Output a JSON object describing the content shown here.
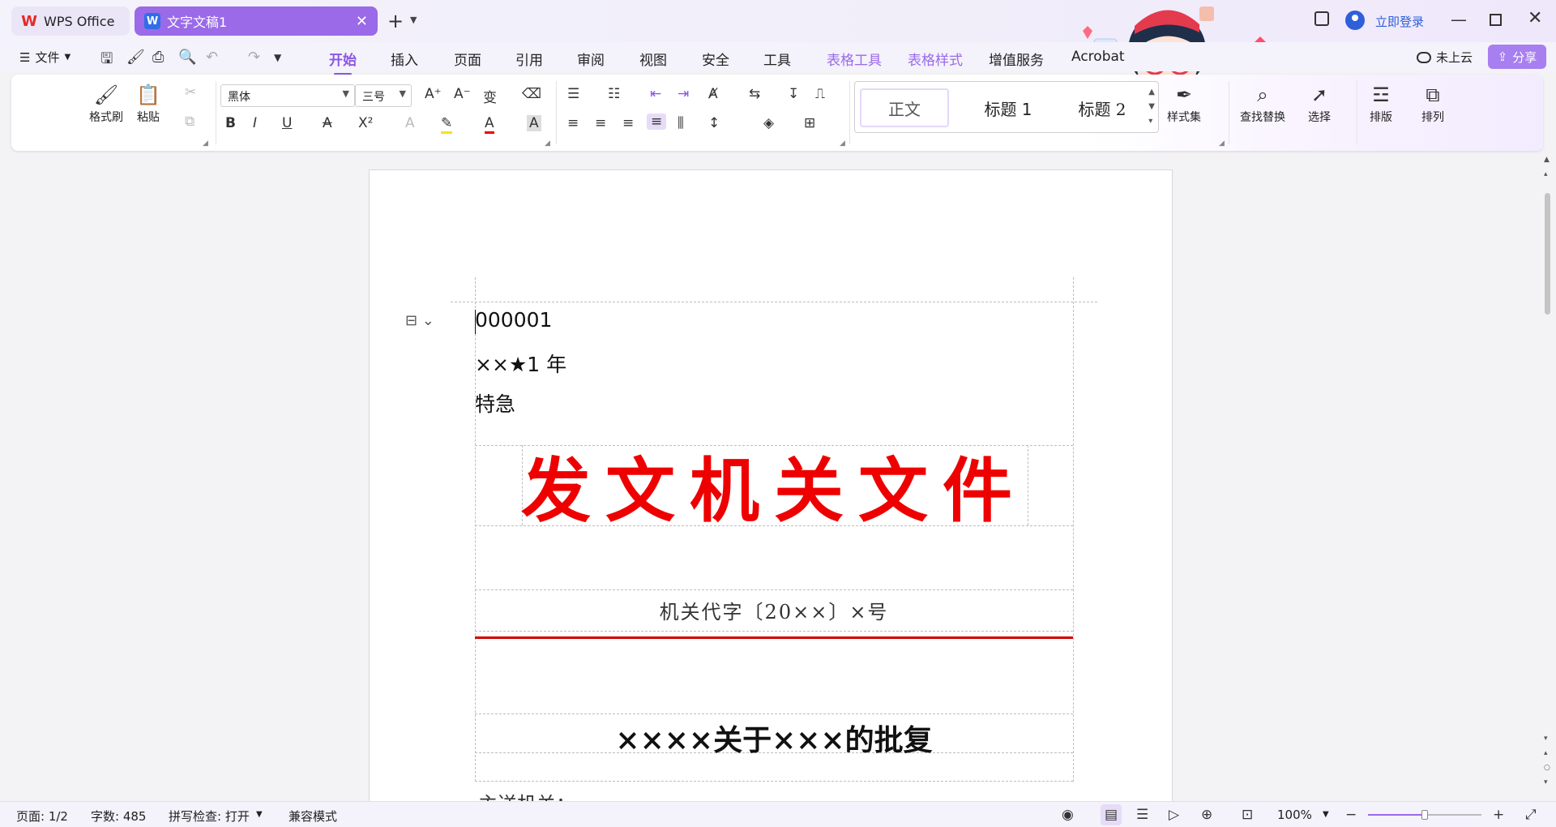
{
  "titlebar": {
    "home_tab": "WPS Office",
    "doc_tab": "文字文稿1",
    "login": "立即登录"
  },
  "menubar": {
    "file": "文件",
    "tabs": [
      "开始",
      "插入",
      "页面",
      "引用",
      "审阅",
      "视图",
      "安全",
      "工具",
      "表格工具",
      "表格样式",
      "增值服务",
      "Acrobat"
    ],
    "active_tab": "开始",
    "cloud": "未上云",
    "share": "分享"
  },
  "ribbon": {
    "format_painter": "格式刷",
    "paste": "粘贴",
    "font_name": "黑体",
    "font_size": "三号",
    "styles": [
      "正文",
      "标题 1",
      "标题 2"
    ],
    "style_set": "样式集",
    "find_replace": "查找替换",
    "select": "选择",
    "layout": "排版",
    "arrange": "排列"
  },
  "document": {
    "serial": "000001",
    "secret": "××★1 年",
    "urgency": "特急",
    "header_title": "发文机关文件",
    "doc_number": "机关代字〔20××〕×号",
    "reply_title": "××××关于×××的批复",
    "recipient": "主送机关："
  },
  "status": {
    "page": "页面: 1/2",
    "words": "字数: 485",
    "spell": "拼写检查: 打开",
    "compat": "兼容模式",
    "zoom": "100%",
    "zoom_fraction": 0.5
  },
  "colors": {
    "accent": "#8b56e4",
    "doc_tab": "#9a6ae8",
    "red_header": "#ee0000"
  }
}
